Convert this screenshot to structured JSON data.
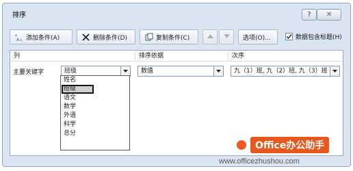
{
  "window": {
    "title": "排序",
    "help_label": "?",
    "close_label": "✕"
  },
  "toolbar": {
    "add_label": "添加条件(A)",
    "delete_label": "删除条件(D)",
    "copy_label": "复制条件(C)",
    "options_label": "选项(O)...",
    "header_checkbox_label": "数据包含标题(H)",
    "header_checkbox_checked": true
  },
  "table": {
    "headers": {
      "column": "列",
      "sort_on": "排序依据",
      "order": "次序"
    },
    "row": {
      "label": "主要关键字",
      "column_value": "班级",
      "sort_on_value": "数值",
      "order_value": "九（1）班, 九（2）班, 九（3）班"
    }
  },
  "dropdown": {
    "options": [
      "姓名",
      "班级",
      "语文",
      "数学",
      "外语",
      "科学",
      "总分"
    ],
    "selected_index": 1
  },
  "watermark": {
    "brand": "Office办公助手",
    "url": "www.officezhushou.com"
  },
  "colors": {
    "dialog_bg": "#dbe5f2",
    "brand": "#e8571b"
  }
}
